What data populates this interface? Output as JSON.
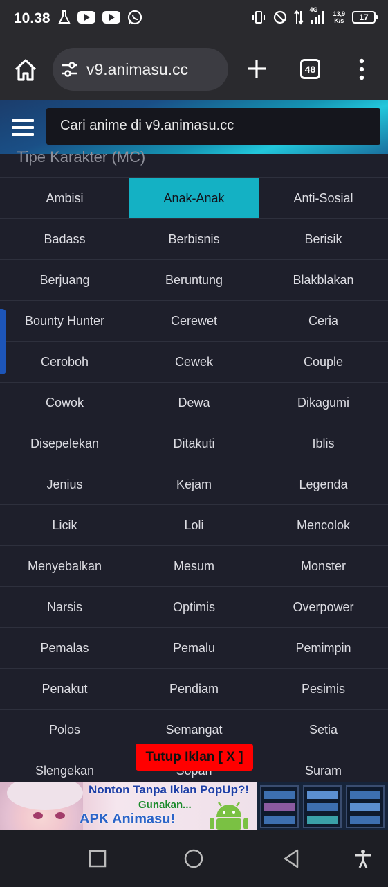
{
  "status": {
    "time": "10.38",
    "network_type": "4G",
    "speed": "13,9",
    "speed_unit": "K/s",
    "battery": "17"
  },
  "browser": {
    "url": "v9.animasu.cc",
    "tab_count": "48"
  },
  "site": {
    "search_placeholder": "Cari anime di v9.animasu.cc",
    "accent_color": "#14b1c4"
  },
  "section": {
    "title": "Tipe Karakter (MC)",
    "selected": "Anak-Anak",
    "items": [
      "Ambisi",
      "Anak-Anak",
      "Anti-Sosial",
      "Badass",
      "Berbisnis",
      "Berisik",
      "Berjuang",
      "Beruntung",
      "Blakblakan",
      "Bounty Hunter",
      "Cerewet",
      "Ceria",
      "Ceroboh",
      "Cewek",
      "Couple",
      "Cowok",
      "Dewa",
      "Dikagumi",
      "Disepelekan",
      "Ditakuti",
      "Iblis",
      "Jenius",
      "Kejam",
      "Legenda",
      "Licik",
      "Loli",
      "Mencolok",
      "Menyebalkan",
      "Mesum",
      "Monster",
      "Narsis",
      "Optimis",
      "Overpower",
      "Pemalas",
      "Pemalu",
      "Pemimpin",
      "Penakut",
      "Pendiam",
      "Pesimis",
      "Polos",
      "Semangat",
      "Setia",
      "Slengekan",
      "Sopan",
      "Suram"
    ]
  },
  "ad": {
    "close_label": "Tutup Iklan [ X ]",
    "line1": "Nonton Tanpa Iklan PopUp?!",
    "line2": "Gunakan...",
    "line3": "APK Animasu!"
  }
}
